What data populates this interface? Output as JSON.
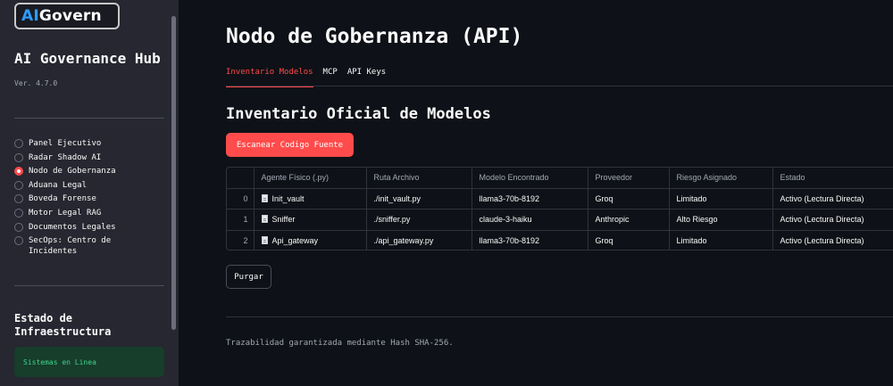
{
  "sidebar": {
    "logo": {
      "ai": "AI",
      "rest": "Govern"
    },
    "title": "AI Governance Hub",
    "version": "Ver. 4.7.0",
    "nav": [
      {
        "label": "Panel Ejecutivo",
        "selected": false
      },
      {
        "label": "Radar Shadow AI",
        "selected": false
      },
      {
        "label": "Nodo de Gobernanza",
        "selected": true
      },
      {
        "label": "Aduana Legal",
        "selected": false
      },
      {
        "label": "Boveda Forense",
        "selected": false
      },
      {
        "label": "Motor Legal RAG",
        "selected": false
      },
      {
        "label": "Documentos Legales",
        "selected": false
      },
      {
        "label": "SecOps: Centro de Incidentes",
        "selected": false
      }
    ],
    "infra_title": "Estado de Infraestructura",
    "status": "Sistemas en Linea"
  },
  "main": {
    "title": "Nodo de Gobernanza (API)",
    "tabs": [
      {
        "label": "Inventario Modelos",
        "active": true
      },
      {
        "label": "MCP",
        "active": false
      },
      {
        "label": "API Keys",
        "active": false
      }
    ],
    "section_title": "Inventario Oficial de Modelos",
    "scan_button": "Escanear Codigo Fuente",
    "table": {
      "columns": [
        "",
        "Agente Físico (.py)",
        "Ruta Archivo",
        "Modelo Encontrado",
        "Proveedor",
        "Riesgo Asignado",
        "Estado"
      ],
      "rows": [
        [
          "0",
          "Init_vault",
          "./init_vault.py",
          "llama3-70b-8192",
          "Groq",
          "Limitado",
          "Activo (Lectura Directa)"
        ],
        [
          "1",
          "Sniffer",
          "./sniffer.py",
          "claude-3-haiku",
          "Anthropic",
          "Alto Riesgo",
          "Activo (Lectura Directa)"
        ],
        [
          "2",
          "Api_gateway",
          "./api_gateway.py",
          "llama3-70b-8192",
          "Groq",
          "Limitado",
          "Activo (Lectura Directa)"
        ]
      ]
    },
    "purge_button": "Purgar",
    "footer": "Trazabilidad garantizada mediante Hash SHA-256."
  },
  "colors": {
    "accent": "#ff4b4b",
    "background": "#0e1117",
    "sidebar": "#262730",
    "logo_ai": "#2f9bff",
    "status_text": "#3dd68c",
    "status_bg": "#173d2b"
  },
  "icons": {
    "file": "file-icon",
    "radio": "radio-icon"
  }
}
